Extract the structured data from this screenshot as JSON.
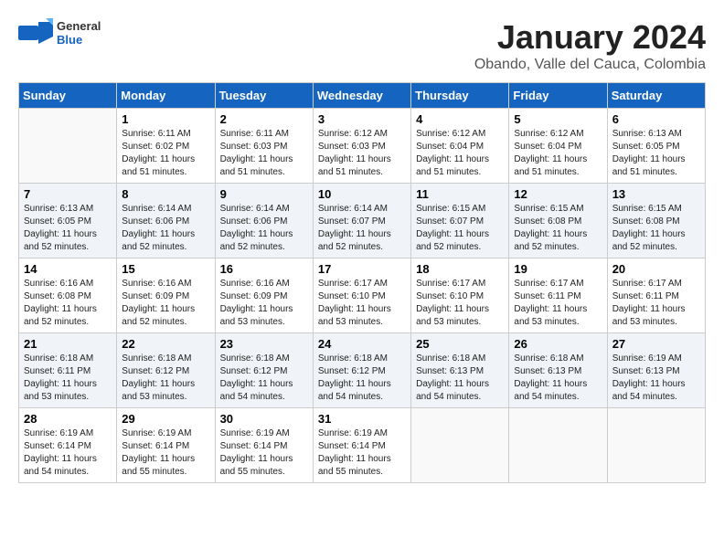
{
  "logo": {
    "general": "General",
    "blue": "Blue"
  },
  "title": "January 2024",
  "location": "Obando, Valle del Cauca, Colombia",
  "days_of_week": [
    "Sunday",
    "Monday",
    "Tuesday",
    "Wednesday",
    "Thursday",
    "Friday",
    "Saturday"
  ],
  "weeks": [
    [
      {
        "day": "",
        "info": ""
      },
      {
        "day": "1",
        "info": "Sunrise: 6:11 AM\nSunset: 6:02 PM\nDaylight: 11 hours\nand 51 minutes."
      },
      {
        "day": "2",
        "info": "Sunrise: 6:11 AM\nSunset: 6:03 PM\nDaylight: 11 hours\nand 51 minutes."
      },
      {
        "day": "3",
        "info": "Sunrise: 6:12 AM\nSunset: 6:03 PM\nDaylight: 11 hours\nand 51 minutes."
      },
      {
        "day": "4",
        "info": "Sunrise: 6:12 AM\nSunset: 6:04 PM\nDaylight: 11 hours\nand 51 minutes."
      },
      {
        "day": "5",
        "info": "Sunrise: 6:12 AM\nSunset: 6:04 PM\nDaylight: 11 hours\nand 51 minutes."
      },
      {
        "day": "6",
        "info": "Sunrise: 6:13 AM\nSunset: 6:05 PM\nDaylight: 11 hours\nand 51 minutes."
      }
    ],
    [
      {
        "day": "7",
        "info": "Sunrise: 6:13 AM\nSunset: 6:05 PM\nDaylight: 11 hours\nand 52 minutes."
      },
      {
        "day": "8",
        "info": "Sunrise: 6:14 AM\nSunset: 6:06 PM\nDaylight: 11 hours\nand 52 minutes."
      },
      {
        "day": "9",
        "info": "Sunrise: 6:14 AM\nSunset: 6:06 PM\nDaylight: 11 hours\nand 52 minutes."
      },
      {
        "day": "10",
        "info": "Sunrise: 6:14 AM\nSunset: 6:07 PM\nDaylight: 11 hours\nand 52 minutes."
      },
      {
        "day": "11",
        "info": "Sunrise: 6:15 AM\nSunset: 6:07 PM\nDaylight: 11 hours\nand 52 minutes."
      },
      {
        "day": "12",
        "info": "Sunrise: 6:15 AM\nSunset: 6:08 PM\nDaylight: 11 hours\nand 52 minutes."
      },
      {
        "day": "13",
        "info": "Sunrise: 6:15 AM\nSunset: 6:08 PM\nDaylight: 11 hours\nand 52 minutes."
      }
    ],
    [
      {
        "day": "14",
        "info": "Sunrise: 6:16 AM\nSunset: 6:08 PM\nDaylight: 11 hours\nand 52 minutes."
      },
      {
        "day": "15",
        "info": "Sunrise: 6:16 AM\nSunset: 6:09 PM\nDaylight: 11 hours\nand 52 minutes."
      },
      {
        "day": "16",
        "info": "Sunrise: 6:16 AM\nSunset: 6:09 PM\nDaylight: 11 hours\nand 53 minutes."
      },
      {
        "day": "17",
        "info": "Sunrise: 6:17 AM\nSunset: 6:10 PM\nDaylight: 11 hours\nand 53 minutes."
      },
      {
        "day": "18",
        "info": "Sunrise: 6:17 AM\nSunset: 6:10 PM\nDaylight: 11 hours\nand 53 minutes."
      },
      {
        "day": "19",
        "info": "Sunrise: 6:17 AM\nSunset: 6:11 PM\nDaylight: 11 hours\nand 53 minutes."
      },
      {
        "day": "20",
        "info": "Sunrise: 6:17 AM\nSunset: 6:11 PM\nDaylight: 11 hours\nand 53 minutes."
      }
    ],
    [
      {
        "day": "21",
        "info": "Sunrise: 6:18 AM\nSunset: 6:11 PM\nDaylight: 11 hours\nand 53 minutes."
      },
      {
        "day": "22",
        "info": "Sunrise: 6:18 AM\nSunset: 6:12 PM\nDaylight: 11 hours\nand 53 minutes."
      },
      {
        "day": "23",
        "info": "Sunrise: 6:18 AM\nSunset: 6:12 PM\nDaylight: 11 hours\nand 54 minutes."
      },
      {
        "day": "24",
        "info": "Sunrise: 6:18 AM\nSunset: 6:12 PM\nDaylight: 11 hours\nand 54 minutes."
      },
      {
        "day": "25",
        "info": "Sunrise: 6:18 AM\nSunset: 6:13 PM\nDaylight: 11 hours\nand 54 minutes."
      },
      {
        "day": "26",
        "info": "Sunrise: 6:18 AM\nSunset: 6:13 PM\nDaylight: 11 hours\nand 54 minutes."
      },
      {
        "day": "27",
        "info": "Sunrise: 6:19 AM\nSunset: 6:13 PM\nDaylight: 11 hours\nand 54 minutes."
      }
    ],
    [
      {
        "day": "28",
        "info": "Sunrise: 6:19 AM\nSunset: 6:14 PM\nDaylight: 11 hours\nand 54 minutes."
      },
      {
        "day": "29",
        "info": "Sunrise: 6:19 AM\nSunset: 6:14 PM\nDaylight: 11 hours\nand 55 minutes."
      },
      {
        "day": "30",
        "info": "Sunrise: 6:19 AM\nSunset: 6:14 PM\nDaylight: 11 hours\nand 55 minutes."
      },
      {
        "day": "31",
        "info": "Sunrise: 6:19 AM\nSunset: 6:14 PM\nDaylight: 11 hours\nand 55 minutes."
      },
      {
        "day": "",
        "info": ""
      },
      {
        "day": "",
        "info": ""
      },
      {
        "day": "",
        "info": ""
      }
    ]
  ]
}
